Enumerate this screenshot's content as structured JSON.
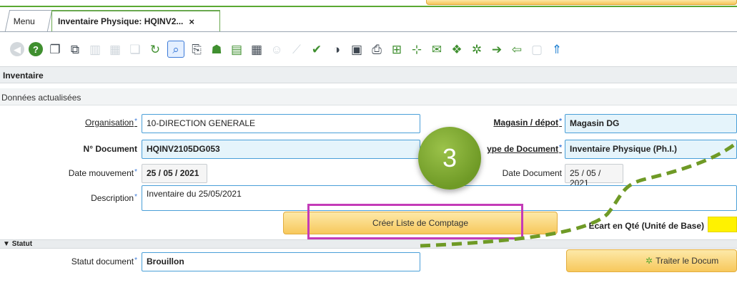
{
  "tabs": {
    "menu_label": "Menu",
    "active_label": "Inventaire Physique: HQINV2...",
    "close_glyph": "×"
  },
  "sections": {
    "inventaire": "Inventaire",
    "status_message": "Données actualisées",
    "statut": "Statut"
  },
  "form": {
    "organisation": {
      "label": "Organisation",
      "value": "10-DIRECTION GENERALE"
    },
    "magasin": {
      "label": "Magasin / dépot",
      "value": "Magasin DG"
    },
    "num_document": {
      "label": "N° Document",
      "value": "HQINV2105DG053"
    },
    "type_document": {
      "label": "ype de Document",
      "value": "Inventaire Physique (Ph.I.)"
    },
    "date_mouvement": {
      "label": "Date mouvement",
      "value": "25 / 05 / 2021"
    },
    "date_document": {
      "label": "Date Document",
      "value": "25 / 05 / 2021"
    },
    "description": {
      "label": "Description",
      "value": "Inventaire du 25/05/2021"
    },
    "ecart": {
      "label": "Ecart en Qté (Unité de Base)"
    },
    "statut_document": {
      "label": "Statut document",
      "value": "Brouillon"
    }
  },
  "buttons": {
    "creer_liste": "Créer Liste de Comptage",
    "traiter": "Traiter le Docum"
  },
  "required_mark": "*",
  "step_badge": "3",
  "colors": {
    "accent_green": "#5aa832",
    "highlight_magenta": "#c43bb8",
    "connector_green": "#6f9a26",
    "button_yellow": "#f7c85c"
  },
  "toolbar_icons": [
    "back-icon",
    "help-icon",
    "copy-icon",
    "copy-details-icon",
    "delete-icon",
    "save-icon",
    "new-icon",
    "refresh-icon",
    "find-icon",
    "attachment-icon",
    "assign-icon",
    "note-icon",
    "grid-icon",
    "user-icon",
    "trend-icon",
    "checklist-icon",
    "chart-icon",
    "report-icon",
    "print-icon",
    "zoom-icon",
    "tree-icon",
    "email-icon",
    "package-icon",
    "workflow-icon",
    "archive-icon",
    "export-icon",
    "lock-icon",
    "upload-icon"
  ]
}
